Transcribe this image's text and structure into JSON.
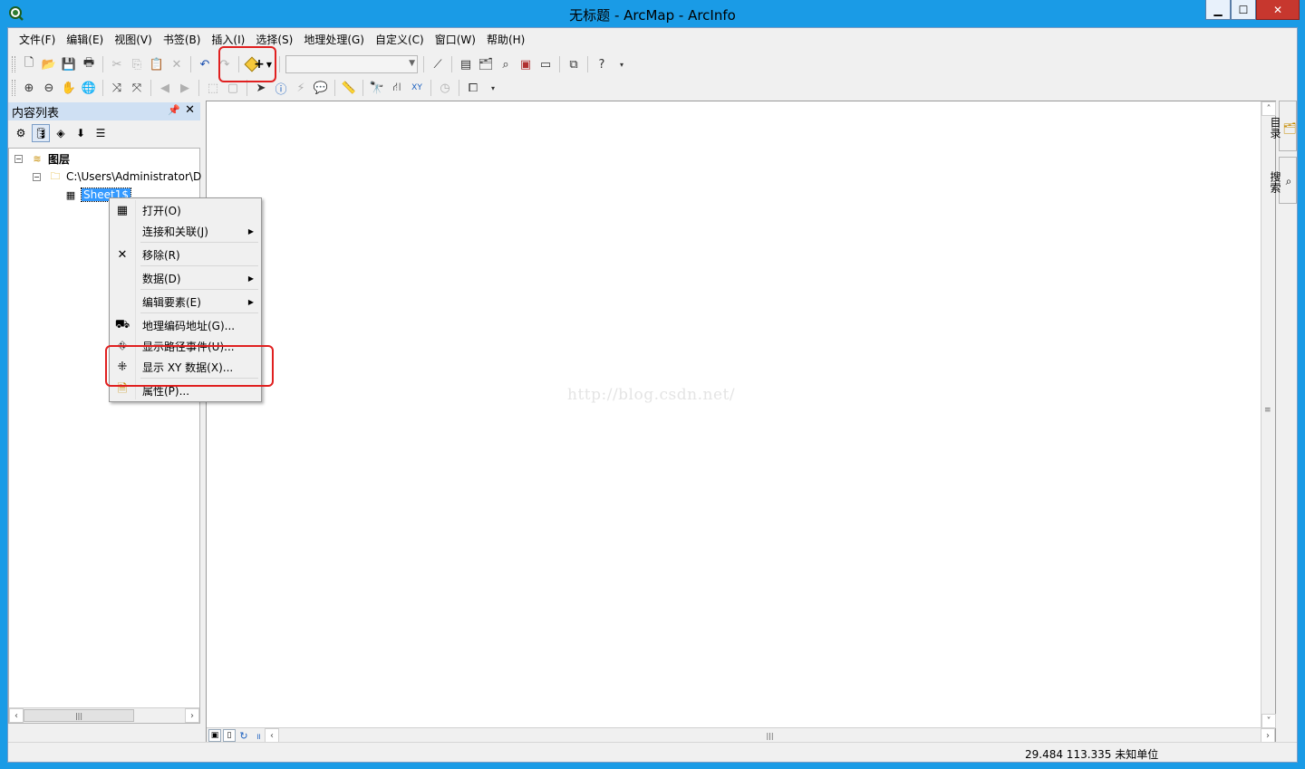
{
  "window": {
    "title": "无标题 - ArcMap - ArcInfo",
    "minimize_glyph": "▁",
    "maximize_glyph": "☐",
    "close_glyph": "✕"
  },
  "menubar": {
    "items": [
      "文件(F)",
      "编辑(E)",
      "视图(V)",
      "书签(B)",
      "插入(I)",
      "选择(S)",
      "地理处理(G)",
      "自定义(C)",
      "窗口(W)",
      "帮助(H)"
    ]
  },
  "toolbar": {
    "scale_value": "",
    "help_glyph": "?"
  },
  "toc": {
    "title": "内容列表",
    "layers_label": "图层",
    "folder_label": "C:\\Users\\Administrator\\D",
    "table_label": "Sheet1$"
  },
  "context_menu": {
    "items": [
      {
        "label": "打开(O)",
        "icon": "table-icon"
      },
      {
        "label": "连接和关联(J)",
        "icon": "none"
      },
      {
        "label": "移除(R)",
        "icon": "remove-icon"
      },
      {
        "label": "数据(D)",
        "icon": "none"
      },
      {
        "label": "编辑要素(E)",
        "icon": "none"
      },
      {
        "label": "地理编码地址(G)...",
        "icon": "geocode-icon"
      },
      {
        "label": "显示路径事件(U)...",
        "icon": "route-icon"
      },
      {
        "label": "显示 XY 数据(X)...",
        "icon": "xy-icon"
      },
      {
        "label": "属性(P)...",
        "icon": "properties-icon"
      }
    ]
  },
  "map": {
    "watermark": "http://blog.csdn.net/"
  },
  "right_dock": {
    "catalog_label": "目录",
    "search_label": "搜索"
  },
  "status": {
    "coordinates": "29.484  113.335 未知单位"
  },
  "colors": {
    "accent": "#1a9be6",
    "selection": "#3399ff",
    "annotation": "#e02020"
  }
}
